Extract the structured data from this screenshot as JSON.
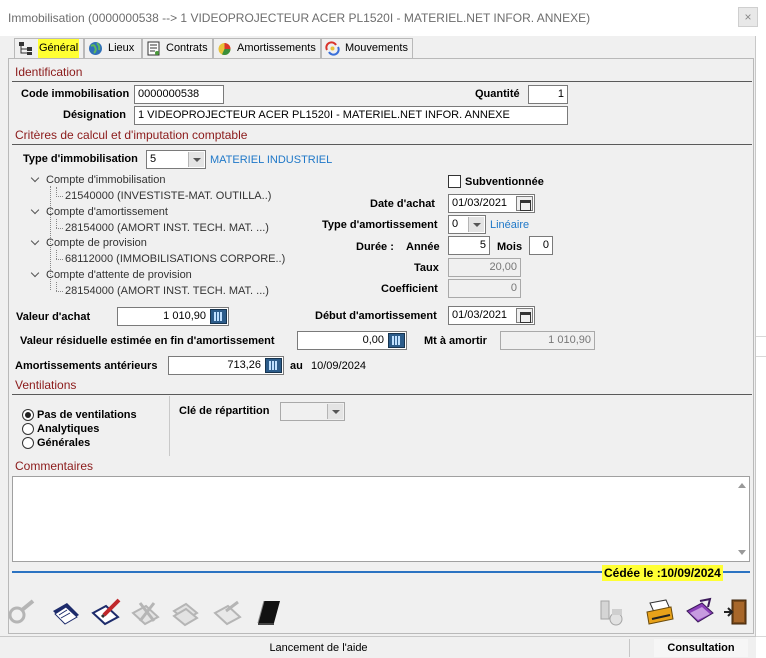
{
  "window": {
    "title": "Immobilisation (0000000538 --> 1 VIDEOPROJECTEUR ACER PL1520I - MATERIEL.NET INFOR. ANNEXE)",
    "close_glyph": "×"
  },
  "tabs": [
    {
      "label": "Général",
      "icon": "hierarchy-icon",
      "active": true
    },
    {
      "label": "Lieux",
      "icon": "globe-icon",
      "active": false
    },
    {
      "label": "Contrats",
      "icon": "contract-icon",
      "active": false
    },
    {
      "label": "Amortissements",
      "icon": "pie-chart-icon",
      "active": false
    },
    {
      "label": "Mouvements",
      "icon": "movement-icon",
      "active": false
    }
  ],
  "identification": {
    "section_title": "Identification",
    "code_label": "Code immobilisation",
    "code_value": "0000000538",
    "quantite_label": "Quantité",
    "quantite_value": "1",
    "designation_label": "Désignation",
    "designation_value": "1 VIDEOPROJECTEUR ACER PL1520I - MATERIEL.NET INFOR. ANNEXE"
  },
  "criteres": {
    "section_title": "Critères de calcul et d'imputation comptable",
    "type_label": "Type d'immobilisation",
    "type_value": "5",
    "type_desc": "MATERIEL INDUSTRIEL",
    "tree": [
      {
        "label": "Compte d'immobilisation",
        "child": "21540000 (INVESTISTE-MAT. OUTILLA..)"
      },
      {
        "label": "Compte d'amortissement",
        "child": "28154000 (AMORT INST. TECH. MAT. ...)"
      },
      {
        "label": "Compte de provision",
        "child": "68112000 (IMMOBILISATIONS CORPORE..)"
      },
      {
        "label": "Compte d'attente de provision",
        "child": "28154000 (AMORT INST. TECH. MAT. ...)"
      }
    ],
    "subventionnee_label": "Subventionnée",
    "subventionnee_checked": false,
    "date_achat_label": "Date d'achat",
    "date_achat_value": "01/03/2021",
    "type_amort_label": "Type d'amortissement",
    "type_amort_value": "0",
    "type_amort_desc": "Linéaire",
    "duree_label": "Durée :",
    "annee_label": "Année",
    "annee_value": "5",
    "mois_label": "Mois",
    "mois_value": "0",
    "taux_label": "Taux",
    "taux_value": "20,00",
    "coef_label": "Coefficient",
    "coef_value": "0",
    "valeur_achat_label": "Valeur d'achat",
    "valeur_achat_value": "1 010,90",
    "debut_amort_label": "Début d'amortissement",
    "debut_amort_value": "01/03/2021",
    "valeur_res_label": "Valeur résiduelle estimée en fin d'amortissement",
    "valeur_res_value": "0,00",
    "mt_amortir_label": "Mt à amortir",
    "mt_amortir_value": "1 010,90",
    "amort_ant_label": "Amortissements antérieurs",
    "amort_ant_value": "713,26",
    "au_label": "au",
    "au_date": "10/09/2024"
  },
  "ventilations": {
    "section_title": "Ventilations",
    "options": [
      {
        "label": "Pas de ventilations",
        "selected": true
      },
      {
        "label": "Analytiques",
        "selected": false
      },
      {
        "label": "Générales",
        "selected": false
      }
    ],
    "cle_label": "Clé de répartition",
    "cle_value": ""
  },
  "commentaires": {
    "section_title": "Commentaires",
    "value": ""
  },
  "cede_text": "Cédée le :10/09/2024",
  "toolbar": [
    {
      "name": "search-icon"
    },
    {
      "name": "validate-icon"
    },
    {
      "name": "edit-icon"
    },
    {
      "name": "delete-icon"
    },
    {
      "name": "copy-icon"
    },
    {
      "name": "history-icon"
    },
    {
      "name": "book-icon"
    },
    {
      "name": "archive-icon"
    },
    {
      "name": "print-icon"
    },
    {
      "name": "export-icon"
    },
    {
      "name": "exit-door-icon"
    }
  ],
  "status": {
    "help_text": "Lancement de l'aide",
    "mode_text": "Consultation"
  }
}
